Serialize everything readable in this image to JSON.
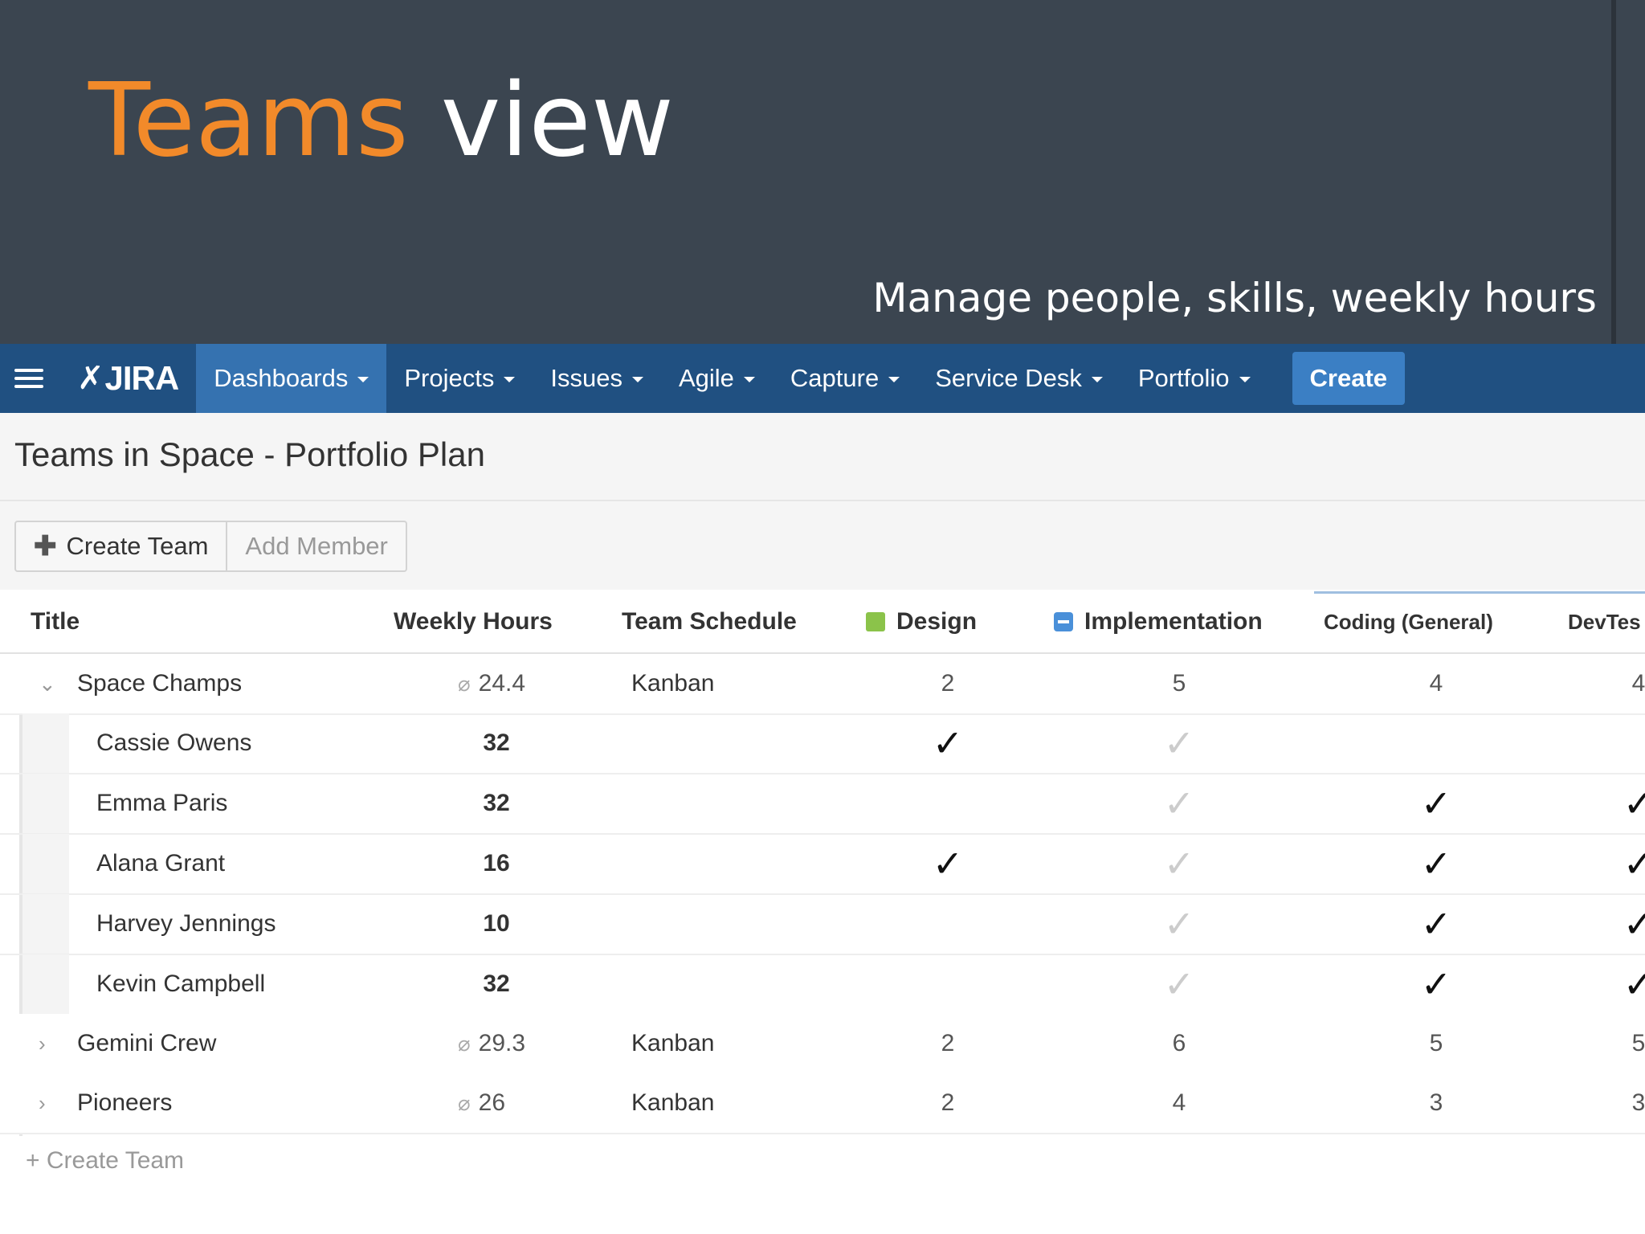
{
  "slide": {
    "title_accent": "Teams",
    "title_rest": " view",
    "subtitle": "Manage people, skills, weekly hours"
  },
  "nav": {
    "logo": "JIRA",
    "items": [
      {
        "label": "Dashboards",
        "dropdown": true,
        "active": true
      },
      {
        "label": "Projects",
        "dropdown": true
      },
      {
        "label": "Issues",
        "dropdown": true
      },
      {
        "label": "Agile",
        "dropdown": true
      },
      {
        "label": "Capture",
        "dropdown": true
      },
      {
        "label": "Service Desk",
        "dropdown": true
      },
      {
        "label": "Portfolio",
        "dropdown": true
      }
    ],
    "create_label": "Create"
  },
  "page": {
    "title": "Teams in Space - Portfolio Plan",
    "create_team_label": "Create Team",
    "add_member_label": "Add Member",
    "footer_create_label": "+ Create Team"
  },
  "table": {
    "headers": {
      "title": "Title",
      "weekly_hours": "Weekly Hours",
      "team_schedule": "Team Schedule",
      "design": "Design",
      "implementation": "Implementation",
      "coding": "Coding (General)",
      "devtest": "DevTes"
    },
    "rows": [
      {
        "kind": "team",
        "expanded": true,
        "name": "Space Champs",
        "hours": "24.4",
        "schedule": "Kanban",
        "design": "2",
        "implementation": "5",
        "coding": "4",
        "devtest": "4"
      },
      {
        "kind": "member",
        "name": "Cassie Owens",
        "hours": "32",
        "design": true,
        "implementation": true,
        "coding": false,
        "devtest": false
      },
      {
        "kind": "member",
        "name": "Emma Paris",
        "hours": "32",
        "design": false,
        "implementation": true,
        "coding": true,
        "devtest": true
      },
      {
        "kind": "member",
        "name": "Alana Grant",
        "hours": "16",
        "design": true,
        "implementation": true,
        "coding": true,
        "devtest": true
      },
      {
        "kind": "member",
        "name": "Harvey Jennings",
        "hours": "10",
        "design": false,
        "implementation": true,
        "coding": true,
        "devtest": true
      },
      {
        "kind": "member",
        "name": "Kevin Campbell",
        "hours": "32",
        "design": false,
        "implementation": true,
        "coding": true,
        "devtest": true
      },
      {
        "kind": "team",
        "expanded": false,
        "name": "Gemini Crew",
        "hours": "29.3",
        "schedule": "Kanban",
        "design": "2",
        "implementation": "6",
        "coding": "5",
        "devtest": "5"
      },
      {
        "kind": "team",
        "expanded": false,
        "name": "Pioneers",
        "hours": "26",
        "schedule": "Kanban",
        "design": "2",
        "implementation": "4",
        "coding": "3",
        "devtest": "3"
      }
    ]
  },
  "colors": {
    "slide_bg": "#3b4550",
    "accent_orange": "#f28a2a",
    "jira_nav": "#205081",
    "nav_active": "#3572b0",
    "create_button": "#3b7fc4",
    "design_tag": "#8bc34a",
    "implementation_tag": "#4a90d9"
  }
}
